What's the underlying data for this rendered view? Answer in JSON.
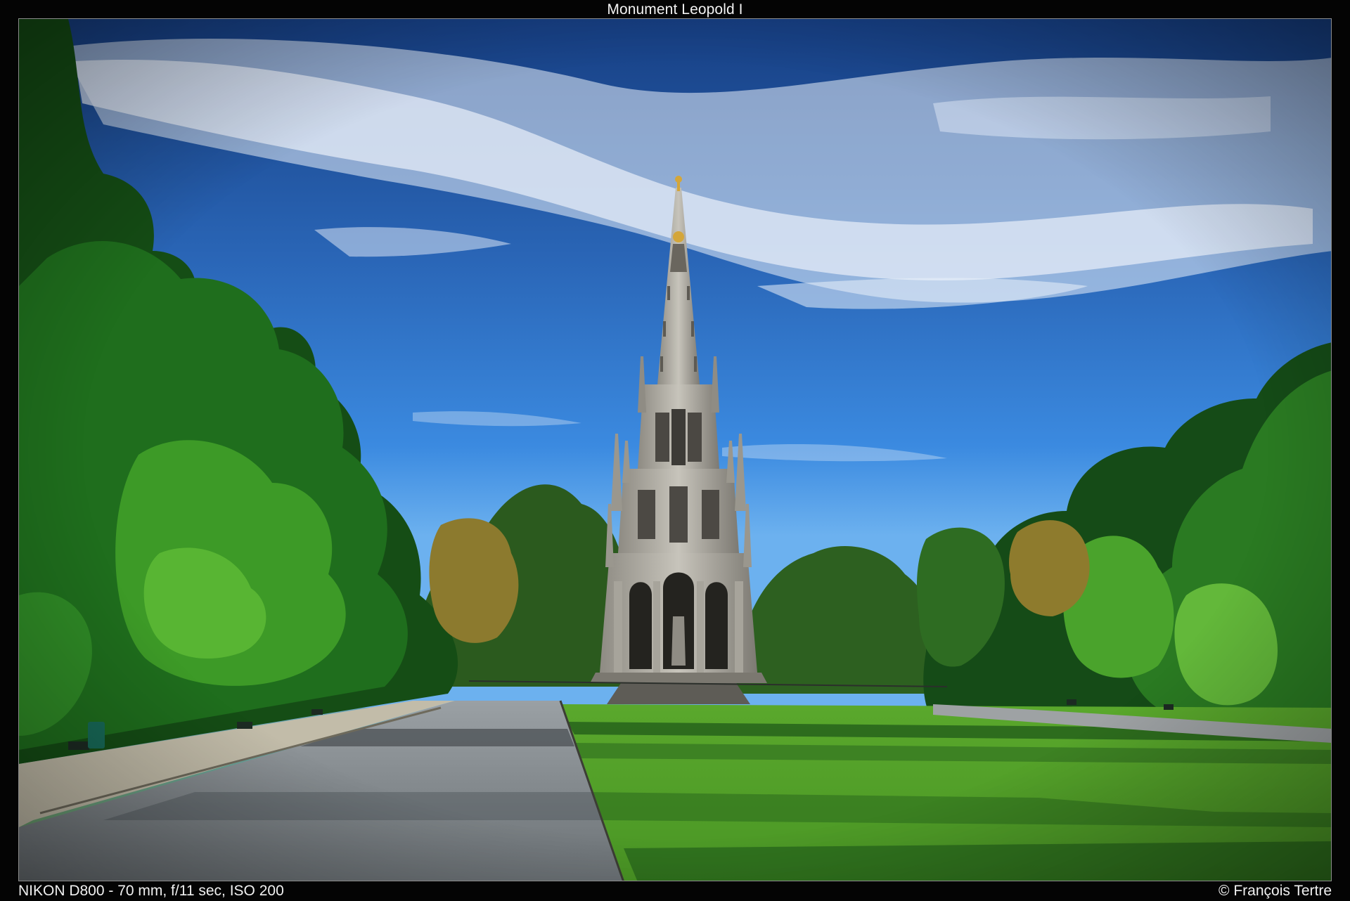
{
  "photo": {
    "title": "Monument Leopold I",
    "camera_info": "NIKON D800 - 70 mm, f/11 sec, ISO 200",
    "credit": "© François Tertre"
  },
  "scene": {
    "subject": "gothic-revival-spire-monument",
    "colors": {
      "sky_top": "#1f4f96",
      "sky_mid": "#2f72c4",
      "sky_horizon": "#6fb0ee",
      "cloud": "#eaf1fb",
      "tree_dark": "#0f3d13",
      "tree_mid": "#1f6b1c",
      "tree_light": "#4aa22a",
      "autumn": "#9c7a2c",
      "stone": "#b7b5ad",
      "stone_shadow": "#55524c",
      "gold": "#d4a63a",
      "lawn_light": "#6fc43a",
      "lawn_shadow": "#1f5a1a",
      "path": "#8e9397",
      "path_shadow": "#4d5357",
      "gravel": "#c2bca9"
    }
  }
}
